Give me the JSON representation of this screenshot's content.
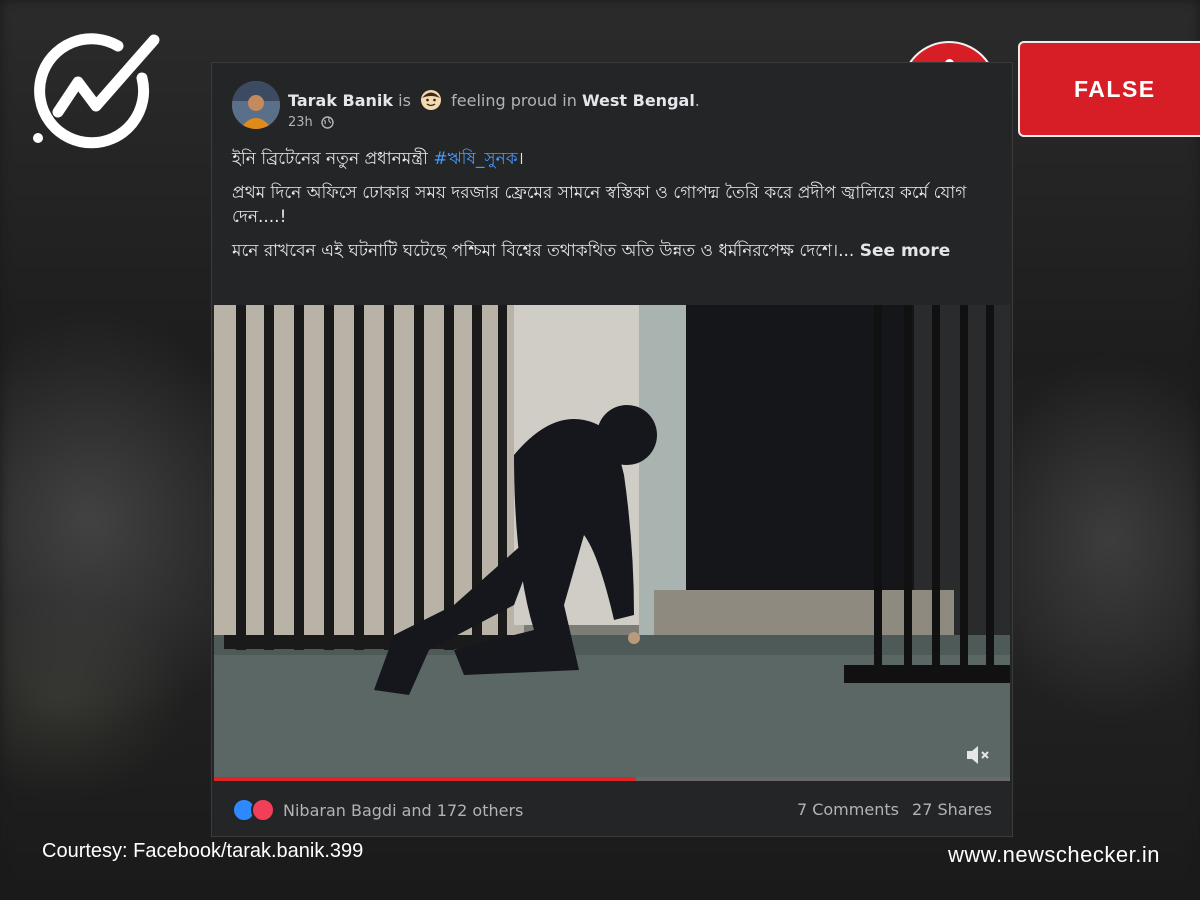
{
  "brand": {
    "logo_icon": "newschecker-check-logo-icon",
    "alert_icon": "exclamation-icon",
    "verdict": "FALSE",
    "verdict_color": "#d71e26",
    "website": "www.newschecker.in"
  },
  "courtesy": "Courtesy: Facebook/tarak.banik.399",
  "post": {
    "author": "Tarak Banik",
    "is_word": "is",
    "feeling_emoji_icon": "proud-face-emoji-icon",
    "feeling_text": "feeling proud in",
    "location": "West Bengal",
    "location_suffix": ".",
    "time": "23h",
    "privacy_icon": "globe-icon",
    "line1_text": "ইনি ব্রিটেনের নতুন প্রধানমন্ত্রী ",
    "hashtag": "#ঋষি_সুনক",
    "line1_end": "।",
    "line2": "প্রথম দিনে অফিসে ঢোকার সময় দরজার ফ্রেমের সামনে স্বস্তিকা ও গোপদ্ম তৈরি করে প্রদীপ জ্বালিয়ে কর্মে যোগ দেন....!",
    "line3": " মনে রাখবেন এই ঘটনাটি ঘটেছে পশ্চিমা বিশ্বের তথাকথিত অতি উন্নত ও ধর্মনিরপেক্ষ দেশে।...",
    "see_more": "See more"
  },
  "video": {
    "progress_fraction": 0.53,
    "mute_icon": "speaker-muted-icon"
  },
  "footer": {
    "reaction_icons": [
      "like-reaction-icon",
      "love-reaction-icon"
    ],
    "reactors": "Nibaran Bagdi and 172 others",
    "comments": "7 Comments",
    "shares": "27 Shares"
  }
}
